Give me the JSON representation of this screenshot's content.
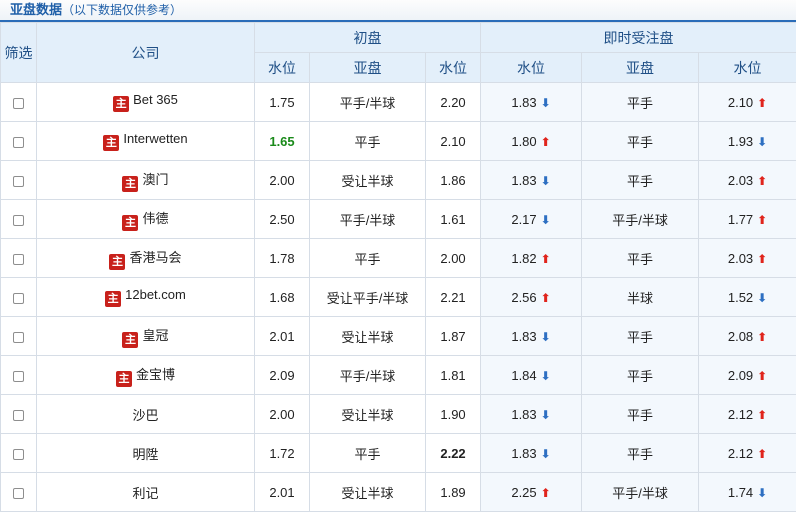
{
  "panel": {
    "title": "亚盘数据",
    "note": "（以下数据仅供参考）"
  },
  "header": {
    "filter": "筛选",
    "company": "公司",
    "initial": "初盘",
    "live": "即时受注盘",
    "sub": [
      "水位",
      "亚盘",
      "水位",
      "水位",
      "亚盘",
      "水位"
    ]
  },
  "host_badge": "主",
  "colors": {
    "up": "#e0241c",
    "down": "#2d6fc2",
    "highlight": "#1a8a1a"
  },
  "rows": [
    {
      "company": "Bet 365",
      "host": true,
      "init_home": "1.75",
      "init_line": "平手/半球",
      "init_away": "2.20",
      "live_home": "1.83",
      "live_home_dir": "down",
      "live_line": "平手",
      "live_away": "2.10",
      "live_away_dir": "up"
    },
    {
      "company": "Interwetten",
      "host": true,
      "init_home": "1.65",
      "init_home_style": "green",
      "init_line": "平手",
      "init_away": "2.10",
      "live_home": "1.80",
      "live_home_dir": "up",
      "live_line": "平手",
      "live_away": "1.93",
      "live_away_dir": "down"
    },
    {
      "company": "澳门",
      "host": true,
      "init_home": "2.00",
      "init_line": "受让半球",
      "init_away": "1.86",
      "live_home": "1.83",
      "live_home_dir": "down",
      "live_line": "平手",
      "live_away": "2.03",
      "live_away_dir": "up"
    },
    {
      "company": "伟德",
      "host": true,
      "init_home": "2.50",
      "init_line": "平手/半球",
      "init_away": "1.61",
      "live_home": "2.17",
      "live_home_dir": "down",
      "live_line": "平手/半球",
      "live_away": "1.77",
      "live_away_dir": "up"
    },
    {
      "company": "香港马会",
      "host": true,
      "init_home": "1.78",
      "init_line": "平手",
      "init_away": "2.00",
      "live_home": "1.82",
      "live_home_dir": "up",
      "live_line": "平手",
      "live_away": "2.03",
      "live_away_dir": "up"
    },
    {
      "company": "12bet.com",
      "host": true,
      "init_home": "1.68",
      "init_line": "受让平手/半球",
      "init_away": "2.21",
      "live_home": "2.56",
      "live_home_dir": "up",
      "live_line": "半球",
      "live_away": "1.52",
      "live_away_dir": "down"
    },
    {
      "company": "皇冠",
      "host": true,
      "init_home": "2.01",
      "init_line": "受让半球",
      "init_away": "1.87",
      "live_home": "1.83",
      "live_home_dir": "down",
      "live_line": "平手",
      "live_away": "2.08",
      "live_away_dir": "up"
    },
    {
      "company": "金宝博",
      "host": true,
      "init_home": "2.09",
      "init_line": "平手/半球",
      "init_away": "1.81",
      "live_home": "1.84",
      "live_home_dir": "down",
      "live_line": "平手",
      "live_away": "2.09",
      "live_away_dir": "up"
    },
    {
      "company": "沙巴",
      "host": false,
      "init_home": "2.00",
      "init_line": "受让半球",
      "init_away": "1.90",
      "live_home": "1.83",
      "live_home_dir": "down",
      "live_line": "平手",
      "live_away": "2.12",
      "live_away_dir": "up"
    },
    {
      "company": "明陞",
      "host": false,
      "init_home": "1.72",
      "init_line": "平手",
      "init_away": "2.22",
      "init_away_style": "bold",
      "live_home": "1.83",
      "live_home_dir": "down",
      "live_line": "平手",
      "live_away": "2.12",
      "live_away_dir": "up"
    },
    {
      "company": "利记",
      "host": false,
      "init_home": "2.01",
      "init_line": "受让半球",
      "init_away": "1.89",
      "live_home": "2.25",
      "live_home_dir": "up",
      "live_line": "平手/半球",
      "live_away": "1.74",
      "live_away_dir": "down"
    }
  ]
}
